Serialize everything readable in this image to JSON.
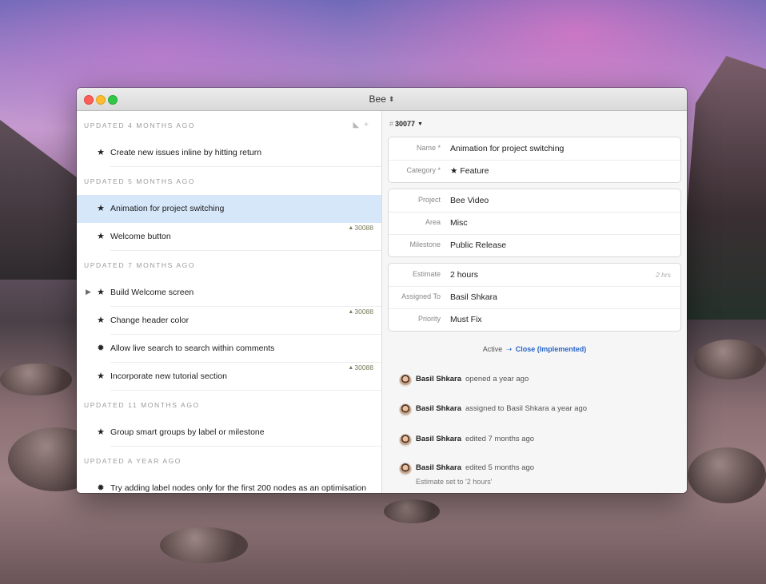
{
  "window": {
    "title": "Bee"
  },
  "sidebar": {
    "sections": [
      {
        "header": "UPDATED 4 MONTHS AGO",
        "items": [
          {
            "icon": "star-icon",
            "title": "Create new issues inline by hitting return",
            "ref": ""
          }
        ]
      },
      {
        "header": "UPDATED 5 MONTHS AGO",
        "items": [
          {
            "icon": "star-icon",
            "title": "Animation for project switching",
            "ref": "",
            "selected": true
          },
          {
            "icon": "star-icon",
            "title": "Welcome button",
            "ref": "30088"
          }
        ]
      },
      {
        "header": "UPDATED 7 MONTHS AGO",
        "items": [
          {
            "icon": "star-icon",
            "title": "Build Welcome screen",
            "ref": "",
            "disclosure": true
          },
          {
            "icon": "star-icon",
            "title": "Change header color",
            "ref": "30088"
          },
          {
            "icon": "bug-icon",
            "title": "Allow live search to search within comments",
            "ref": ""
          },
          {
            "icon": "star-icon",
            "title": "Incorporate new tutorial section",
            "ref": "30088"
          }
        ]
      },
      {
        "header": "UPDATED 11 MONTHS AGO",
        "items": [
          {
            "icon": "star-icon",
            "title": "Group smart groups by label or milestone",
            "ref": ""
          }
        ]
      },
      {
        "header": "UPDATED A YEAR AGO",
        "items": [
          {
            "icon": "bug-icon",
            "title": "Try adding label nodes only for the first 200 nodes as an optimisation",
            "ref": ""
          }
        ]
      }
    ]
  },
  "detail": {
    "issue_hash": "#",
    "issue_id": "30077",
    "cards": [
      {
        "fields": [
          {
            "label": "Name *",
            "value": "Animation for project switching",
            "hint": ""
          },
          {
            "label": "Category *",
            "value": "★ Feature",
            "hint": ""
          }
        ]
      },
      {
        "fields": [
          {
            "label": "Project",
            "value": "Bee Video",
            "hint": ""
          },
          {
            "label": "Area",
            "value": "Misc",
            "hint": ""
          },
          {
            "label": "Milestone",
            "value": "Public Release",
            "hint": ""
          }
        ]
      },
      {
        "fields": [
          {
            "label": "Estimate",
            "value": "2 hours",
            "hint": "2 hrs"
          },
          {
            "label": "Assigned To",
            "value": "Basil Shkara",
            "hint": ""
          },
          {
            "label": "Priority",
            "value": "Must Fix",
            "hint": ""
          }
        ]
      }
    ],
    "status": {
      "current": "Active",
      "arrow": "➝",
      "action": "Close (Implemented)"
    },
    "activity": [
      {
        "author": "Basil Shkara",
        "text": "opened a year ago",
        "detail": ""
      },
      {
        "author": "Basil Shkara",
        "text": "assigned to Basil Shkara a year ago",
        "detail": ""
      },
      {
        "author": "Basil Shkara",
        "text": "edited 7 months ago",
        "detail": ""
      },
      {
        "author": "Basil Shkara",
        "text": "edited 5 months ago",
        "detail": "Estimate set to '2 hours'"
      }
    ]
  }
}
